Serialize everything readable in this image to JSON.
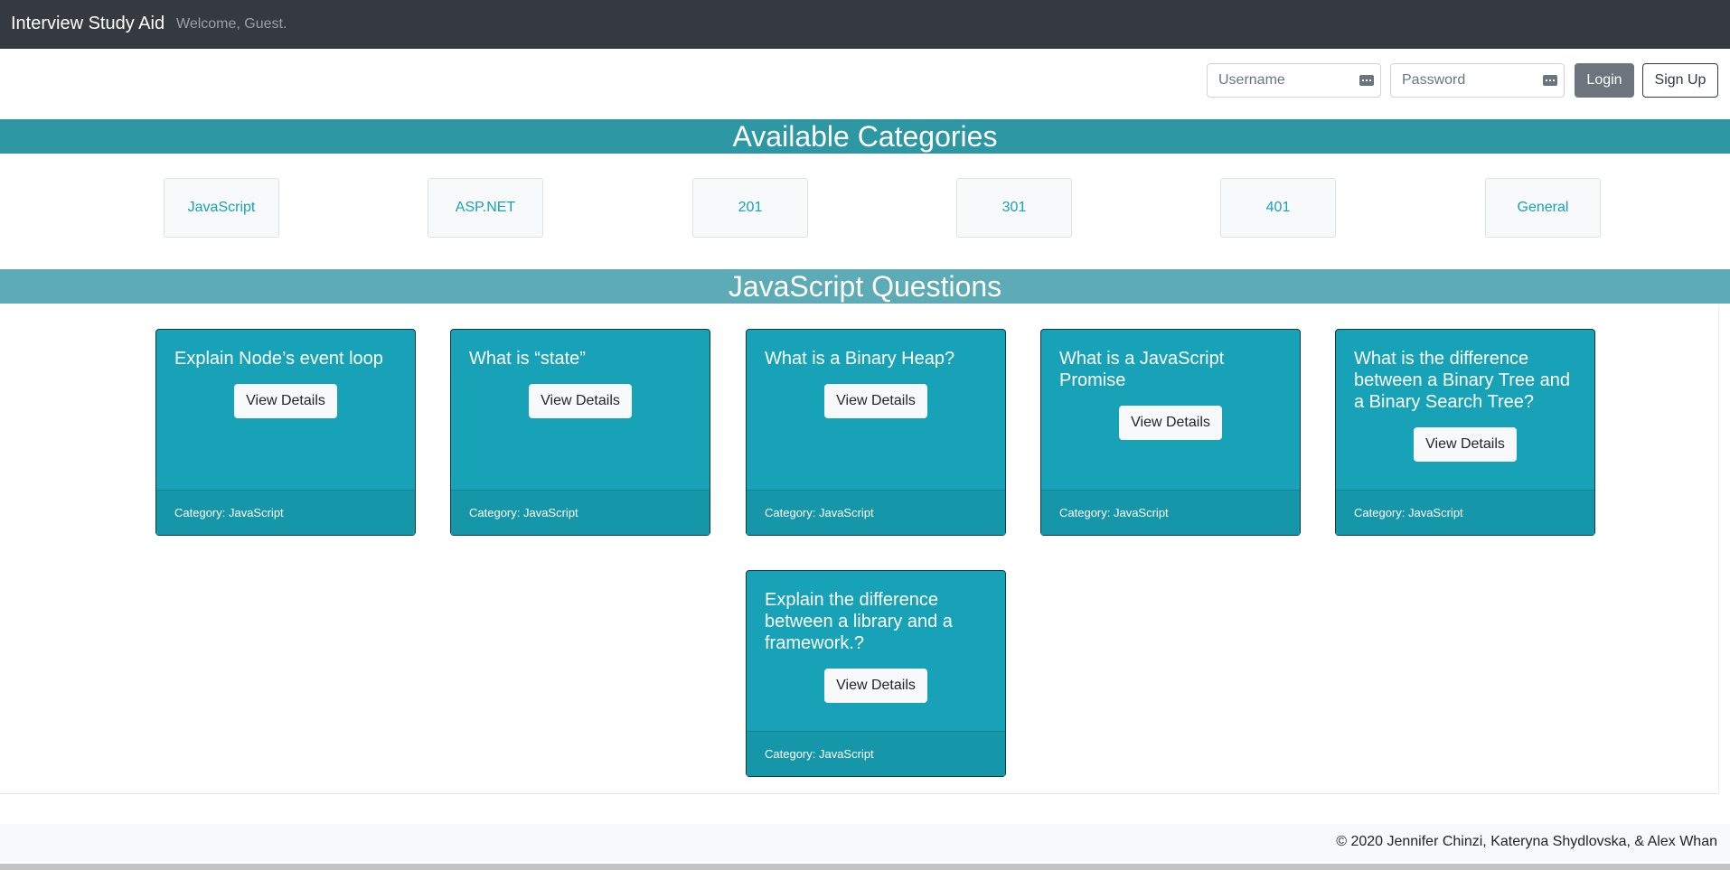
{
  "navbar": {
    "brand": "Interview Study Aid",
    "welcome": "Welcome, Guest."
  },
  "auth": {
    "username_placeholder": "Username",
    "password_placeholder": "Password",
    "login_label": "Login",
    "signup_label": "Sign Up"
  },
  "categories": {
    "heading": "Available Categories",
    "items": [
      "JavaScript",
      "ASP.NET",
      "201",
      "301",
      "401",
      "General"
    ]
  },
  "questions": {
    "heading": "JavaScript Questions",
    "view_label": "View Details",
    "cards": [
      {
        "title": "Explain Node’s event loop",
        "footer": "Category: JavaScript"
      },
      {
        "title": "What is “state”",
        "footer": "Category: JavaScript"
      },
      {
        "title": "What is a Binary Heap?",
        "footer": "Category: JavaScript"
      },
      {
        "title": "What is a JavaScript Promise",
        "footer": "Category: JavaScript"
      },
      {
        "title": "What is the difference between a Binary Tree and a Binary Search Tree?",
        "footer": "Category: JavaScript"
      },
      {
        "title": "Explain the difference between a library and a framework.?",
        "footer": "Category: JavaScript"
      }
    ]
  },
  "footer": {
    "copyright": "© 2020 Jennifer Chinzi, Kateryna Shydlovska, & Alex Whan"
  },
  "colors": {
    "navbar": "#343a40",
    "band_categories": "#2e97a4",
    "band_questions": "#5eabb8",
    "card": "#17a2b8"
  }
}
